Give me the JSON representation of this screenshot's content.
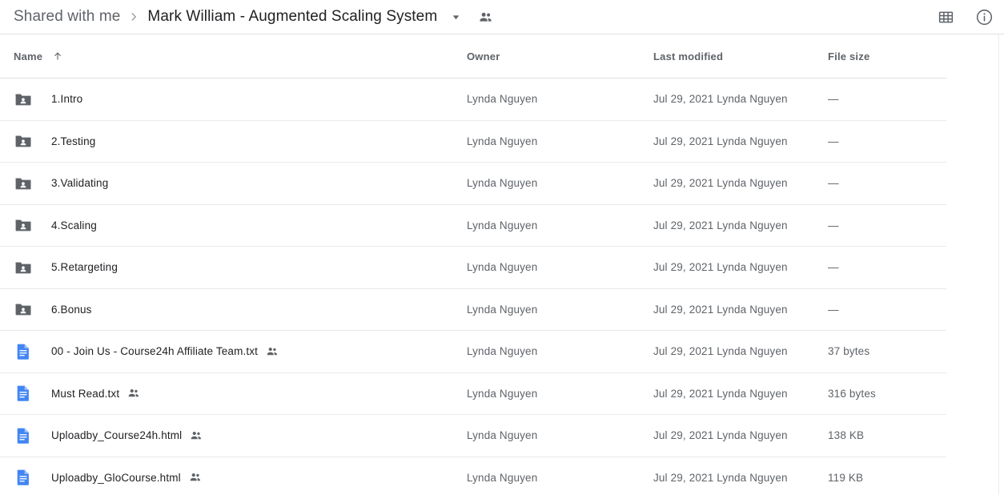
{
  "breadcrumb": {
    "root_label": "Shared with me",
    "separator_icon": "chevron-right-icon",
    "current_label": "Mark William - Augmented Scaling System",
    "caret_icon": "chevron-down-icon",
    "people_icon": "people-icon"
  },
  "toolbar": {
    "grid_view_icon": "grid-view-icon",
    "details_icon": "info-circle-icon"
  },
  "columns": {
    "name": "Name",
    "sort_icon": "arrow-up-icon",
    "owner": "Owner",
    "last_modified": "Last modified",
    "file_size": "File size"
  },
  "rows": [
    {
      "name": "1.Intro",
      "icon": "shared-folder-icon",
      "shared_badge": false,
      "owner": "Lynda Nguyen",
      "modified_date": "Jul 29, 2021",
      "modified_by": "Lynda Nguyen",
      "size": "—"
    },
    {
      "name": "2.Testing",
      "icon": "shared-folder-icon",
      "shared_badge": false,
      "owner": "Lynda Nguyen",
      "modified_date": "Jul 29, 2021",
      "modified_by": "Lynda Nguyen",
      "size": "—"
    },
    {
      "name": "3.Validating",
      "icon": "shared-folder-icon",
      "shared_badge": false,
      "owner": "Lynda Nguyen",
      "modified_date": "Jul 29, 2021",
      "modified_by": "Lynda Nguyen",
      "size": "—"
    },
    {
      "name": "4.Scaling",
      "icon": "shared-folder-icon",
      "shared_badge": false,
      "owner": "Lynda Nguyen",
      "modified_date": "Jul 29, 2021",
      "modified_by": "Lynda Nguyen",
      "size": "—"
    },
    {
      "name": "5.Retargeting",
      "icon": "shared-folder-icon",
      "shared_badge": false,
      "owner": "Lynda Nguyen",
      "modified_date": "Jul 29, 2021",
      "modified_by": "Lynda Nguyen",
      "size": "—"
    },
    {
      "name": "6.Bonus",
      "icon": "shared-folder-icon",
      "shared_badge": false,
      "owner": "Lynda Nguyen",
      "modified_date": "Jul 29, 2021",
      "modified_by": "Lynda Nguyen",
      "size": "—"
    },
    {
      "name": "00 - Join Us - Course24h Affiliate Team.txt",
      "icon": "document-icon",
      "shared_badge": true,
      "owner": "Lynda Nguyen",
      "modified_date": "Jul 29, 2021",
      "modified_by": "Lynda Nguyen",
      "size": "37 bytes"
    },
    {
      "name": "Must Read.txt",
      "icon": "document-icon",
      "shared_badge": true,
      "owner": "Lynda Nguyen",
      "modified_date": "Jul 29, 2021",
      "modified_by": "Lynda Nguyen",
      "size": "316 bytes"
    },
    {
      "name": "Uploadby_Course24h.html",
      "icon": "document-icon",
      "shared_badge": true,
      "owner": "Lynda Nguyen",
      "modified_date": "Jul 29, 2021",
      "modified_by": "Lynda Nguyen",
      "size": "138 KB"
    },
    {
      "name": "Uploadby_GloCourse.html",
      "icon": "document-icon",
      "shared_badge": true,
      "owner": "Lynda Nguyen",
      "modified_date": "Jul 29, 2021",
      "modified_by": "Lynda Nguyen",
      "size": "119 KB"
    }
  ],
  "colors": {
    "folder_icon": "#5f6368",
    "document_icon": "#4285f4",
    "text_primary": "#202124",
    "text_secondary": "#5f6368",
    "divider": "#e8eaed"
  }
}
